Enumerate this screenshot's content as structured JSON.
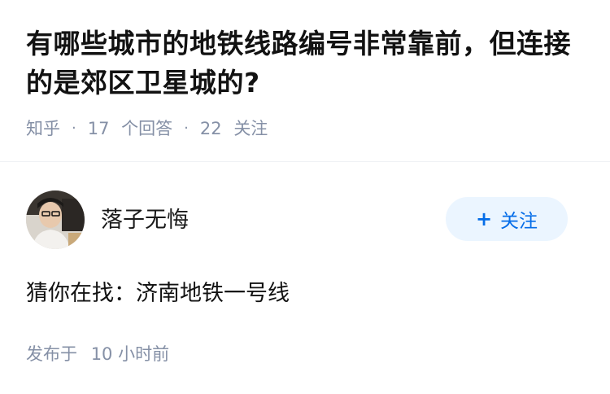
{
  "question": {
    "title": "有哪些城市的地铁线路编号非常靠前，但连接的是郊区卫星城的?"
  },
  "meta": {
    "source": "知乎",
    "answers_count": "17",
    "answers_label": "个回答",
    "followers_count": "22",
    "followers_label": "关注"
  },
  "answer": {
    "author_name": "落子无悔",
    "follow_button": "关注",
    "follow_icon": "plus-icon",
    "content": "猜你在找：济南地铁一号线",
    "publish_label": "发布于",
    "publish_time": "10 小时前"
  },
  "colors": {
    "accent": "#056de8",
    "button_bg": "#ebf5ff",
    "meta_text": "#8590a6"
  }
}
